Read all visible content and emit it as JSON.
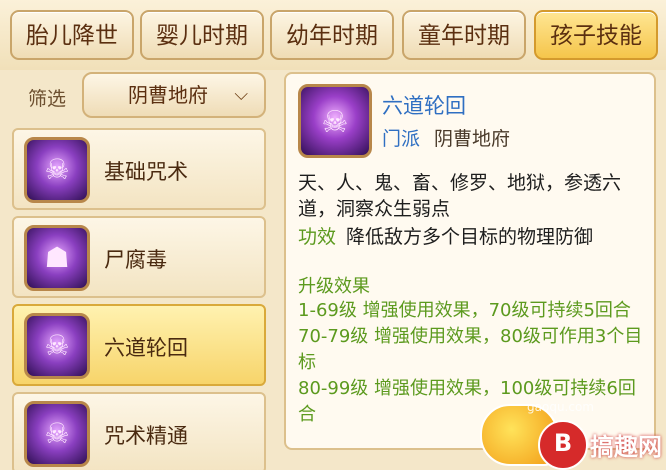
{
  "tabs": [
    {
      "label": "胎儿降世"
    },
    {
      "label": "婴儿时期"
    },
    {
      "label": "幼年时期"
    },
    {
      "label": "童年时期"
    },
    {
      "label": "孩子技能"
    }
  ],
  "filter": {
    "label": "筛选",
    "selected": "阴曹地府"
  },
  "skills": [
    {
      "name": "基础咒术",
      "icon": "purple-skull-spell-icon"
    },
    {
      "name": "尸腐毒",
      "icon": "purple-poison-icon"
    },
    {
      "name": "六道轮回",
      "icon": "reincarnation-wheel-icon"
    },
    {
      "name": "咒术精通",
      "icon": "purple-skull-spell-icon"
    }
  ],
  "selected_skill_index": 2,
  "detail": {
    "title": "六道轮回",
    "school_label": "门派",
    "school_value": "阴曹地府",
    "description": "天、人、鬼、畜、修罗、地狱，参透六道，洞察众生弱点",
    "effect_label": "功效",
    "effect_value": "降低敌方多个目标的物理防御",
    "upgrade_title": "升级效果",
    "upgrades": [
      "1-69级  增强使用效果，70级可持续5回合",
      "70-79级  增强使用效果，80级可作用3个目标",
      "80-99级  增强使用效果，100级可持续6回合"
    ]
  },
  "watermark": {
    "site": "gaoqu.com",
    "brand": "搞趣网",
    "badge_letter": "B"
  },
  "colors": {
    "accent_active_tab": "#f5c54b",
    "title_blue": "#2f6fc2",
    "green_text": "#5c9a1e"
  }
}
